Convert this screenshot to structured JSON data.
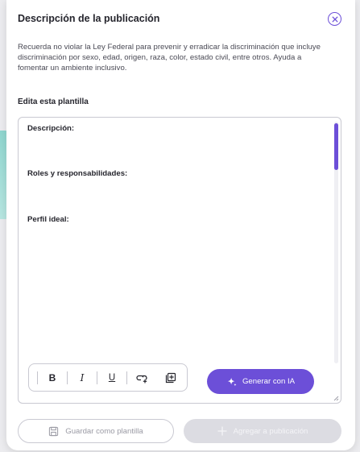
{
  "colors": {
    "accent": "#6c4fd8",
    "border": "#c9c9d2",
    "disabled_bg": "#dcdce2",
    "text": "#25252d"
  },
  "modal": {
    "title": "Descripción de la publicación",
    "close_icon": "close-circle-icon",
    "notice": "Recuerda no violar la Ley Federal para prevenir y erradicar la discriminación que incluye discriminación por sexo, edad, origen, raza, color, estado civil, entre otros. Ayuda a fomentar un ambiente inclusivo."
  },
  "editor": {
    "label": "Edita esta plantilla",
    "fields": [
      "Descripción:",
      "Roles y responsabilidades:",
      "Perfil ideal:"
    ],
    "scroll_position": 0
  },
  "toolbar": {
    "bold_label": "B",
    "italic_label": "I",
    "underline_label": "U",
    "link_icon": "link-icon",
    "insert_icon": "add-box-icon"
  },
  "ai_button": {
    "label": "Generar con IA",
    "icon": "sparkle-icon"
  },
  "footer": {
    "save_label": "Guardar como plantilla",
    "save_icon": "save-icon",
    "add_label": "Agregar a publicación",
    "add_icon": "plus-icon",
    "add_disabled": true
  }
}
